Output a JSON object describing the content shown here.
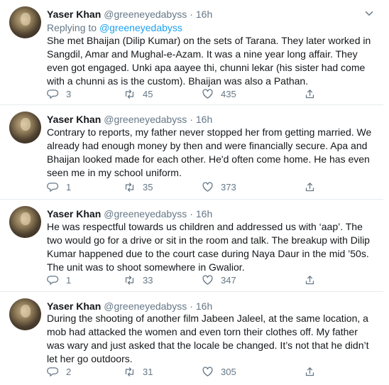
{
  "tweets": [
    {
      "author": "Yaser Khan",
      "handle": "@greeneyedabyss",
      "separator": "·",
      "time": "16h",
      "replying_prefix": "Replying to",
      "replying_handle": "@greeneyedabyss",
      "text": "She met Bhaijan (Dilip Kumar) on the sets of Tarana. They later worked in Sangdil, Amar and Mughal-e-Azam.  It was a nine year long affair. They even got engaged. Unki apa aayee thi, chunni lekar (his sister had come with a chunni as is the custom). Bhaijan was also a Pathan.",
      "replies": "3",
      "retweets": "45",
      "likes": "435"
    },
    {
      "author": "Yaser Khan",
      "handle": "@greeneyedabyss",
      "separator": "·",
      "time": "16h",
      "text": "Contrary to reports, my father never stopped her from getting married. We already had enough money by then and were financially secure. Apa and Bhaijan looked made for each other. He'd often come home. He has even seen me in my school uniform.",
      "replies": "1",
      "retweets": "35",
      "likes": "373"
    },
    {
      "author": "Yaser Khan",
      "handle": "@greeneyedabyss",
      "separator": "·",
      "time": "16h",
      "text": "He was respectful towards us children and addressed us with ‘aap’. The two would go for a drive or sit in the room and talk. The breakup with Dilip Kumar happened due to the court case during Naya Daur in the mid ’50s. The unit was to shoot somewhere in Gwalior.",
      "replies": "1",
      "retweets": "33",
      "likes": "347"
    },
    {
      "author": "Yaser Khan",
      "handle": "@greeneyedabyss",
      "separator": "·",
      "time": "16h",
      "text": "During the shooting of another film Jabeen Jaleel, at the same location, a mob had attacked the women and even torn their clothes off. My father was wary and just asked that the locale be changed. It’s not that he didn’t let her go outdoors.",
      "replies": "2",
      "retweets": "31",
      "likes": "305"
    }
  ],
  "colors": {
    "text": "#14171a",
    "secondary": "#657786",
    "link": "#1da1f2",
    "divider": "#e6ecf0"
  },
  "icons": {
    "reply": "reply-icon",
    "retweet": "retweet-icon",
    "like": "like-icon",
    "share": "share-icon",
    "menu": "chevron-down-icon"
  }
}
